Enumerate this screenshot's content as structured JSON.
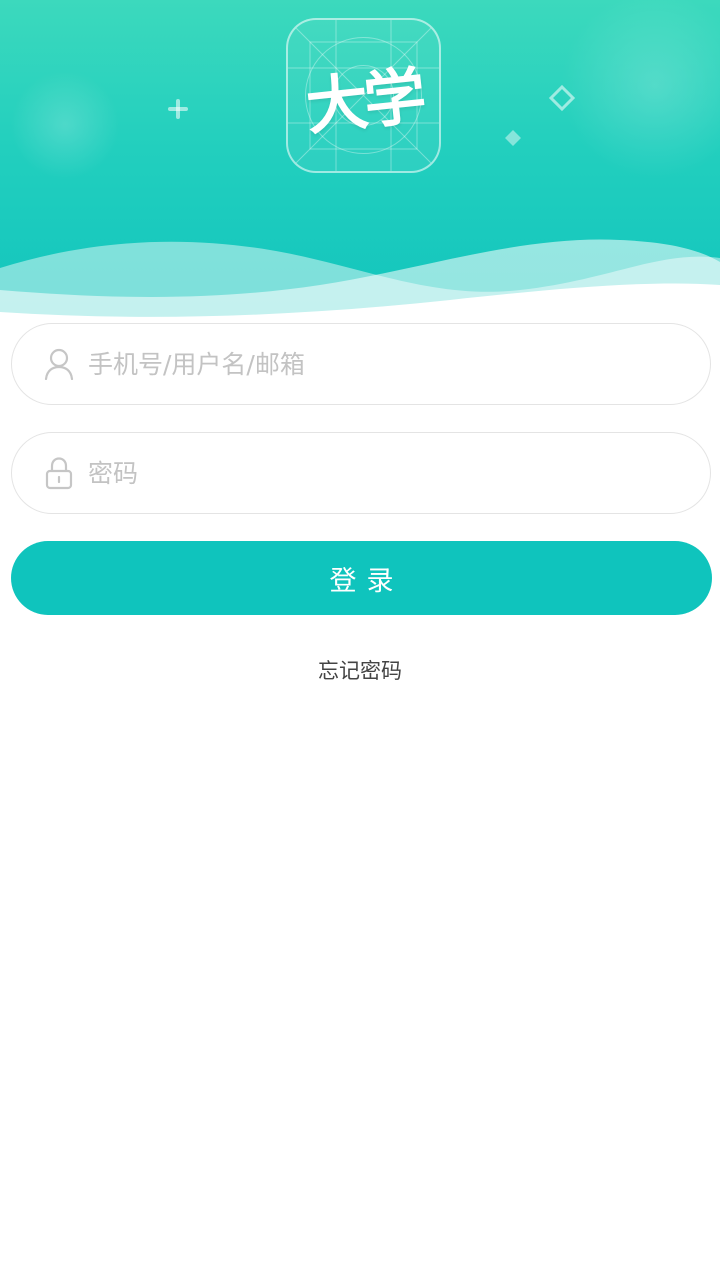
{
  "header": {
    "logo_text": "大学",
    "colors": {
      "gradient_top": "#3cd9bd",
      "gradient_bottom": "#11c4bd"
    }
  },
  "form": {
    "username": {
      "placeholder": "手机号/用户名/邮箱",
      "value": "",
      "icon": "user-icon"
    },
    "password": {
      "placeholder": "密码",
      "value": "",
      "icon": "lock-icon"
    },
    "login_label": "登录",
    "forgot_label": "忘记密码"
  },
  "colors": {
    "accent": "#0fc4bd",
    "placeholder": "#c3c3c3",
    "field_border": "#e4e4e4",
    "link_text": "#444444"
  }
}
